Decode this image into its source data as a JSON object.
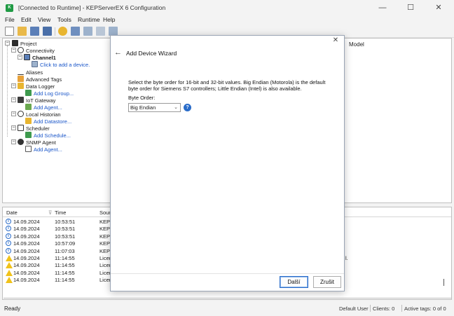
{
  "window": {
    "title": "[Connected to Runtime] - KEPServerEX 6 Configuration",
    "minimize": "—",
    "maximize": "☐",
    "close": "✕"
  },
  "menu": [
    "File",
    "Edit",
    "View",
    "Tools",
    "Runtime",
    "Help"
  ],
  "tree": {
    "project": "Project",
    "connectivity": "Connectivity",
    "channel": "Channel1",
    "click_add_device": "Click to add a device.",
    "aliases": "Aliases",
    "advanced_tags": "Advanced Tags",
    "data_logger": "Data Logger",
    "add_log_group": "Add Log Group...",
    "iot_gateway": "IoT Gateway",
    "add_agent_iot": "Add Agent...",
    "local_historian": "Local Historian",
    "add_datastore": "Add Datastore...",
    "scheduler": "Scheduler",
    "add_schedule": "Add Schedule...",
    "snmp_agent": "SNMP Agent",
    "add_agent_snmp": "Add Agent..."
  },
  "right_pane": {
    "header": "Model"
  },
  "log": {
    "headers": {
      "date": "Date",
      "time": "Time",
      "source": "Sourc"
    },
    "rows": [
      {
        "level": "info",
        "date": "14.09.2024",
        "time": "10:53:51",
        "source": "KEPS"
      },
      {
        "level": "info",
        "date": "14.09.2024",
        "time": "10:53:51",
        "source": "KEPS"
      },
      {
        "level": "info",
        "date": "14.09.2024",
        "time": "10:53:51",
        "source": "KEPS"
      },
      {
        "level": "info",
        "date": "14.09.2024",
        "time": "10:57:09",
        "source": "KEPS"
      },
      {
        "level": "info",
        "date": "14.09.2024",
        "time": "11:07:03",
        "source": "KEPS"
      },
      {
        "level": "warning",
        "date": "14.09.2024",
        "time": "11:14:55",
        "source": "Licen"
      },
      {
        "level": "warning",
        "date": "14.09.2024",
        "time": "11:14:55",
        "source": "Licen"
      },
      {
        "level": "warning",
        "date": "14.09.2024",
        "time": "11:14:55",
        "source": "Licen"
      },
      {
        "level": "warning",
        "date": "14.09.2024",
        "time": "11:14:55",
        "source": "Licen"
      }
    ],
    "row_tail_text": "l."
  },
  "status": {
    "left": "Ready",
    "user": "Default User",
    "clients": "Clients: 0",
    "active_tags": "Active tags: 0 of 0"
  },
  "dialog": {
    "title": "Add Device Wizard",
    "close": "✕",
    "back": "←",
    "description": "Select the byte order for 16-bit and 32-bit values. Big Endian (Motorola) is the default byte order for Siemens S7 controllers; Little Endian (Intel) is also available.",
    "byte_order_label": "Byte Order:",
    "byte_order_value": "Big Endian",
    "help": "?",
    "next_button": "Další",
    "cancel_button": "Zrušit"
  },
  "colors": {
    "accent": "#2a6cc9",
    "link": "#1a56c9",
    "warning": "#f0c21a",
    "app_icon": "#1f9a44"
  }
}
